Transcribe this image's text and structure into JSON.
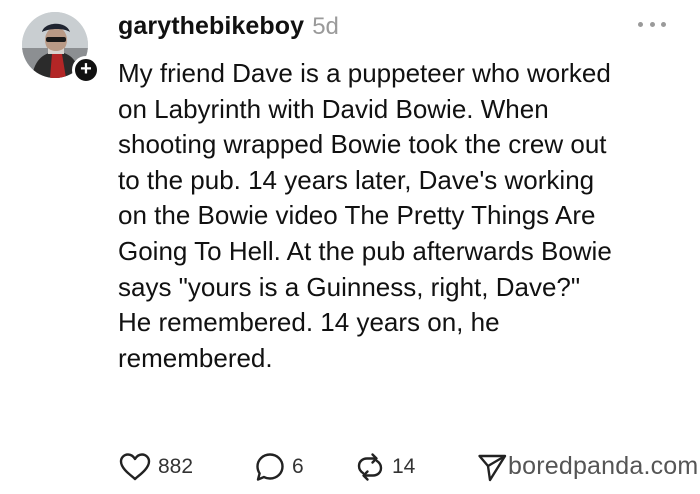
{
  "post": {
    "username": "garythebikeboy",
    "timestamp": "5d",
    "follow_badge": "+",
    "body_lines": [
      "My friend Dave is a puppeteer who worked",
      "on Labyrinth with David Bowie. When",
      "shooting wrapped Bowie took the crew out",
      "to the pub. 14 years later, Dave's working",
      "on the Bowie video The Pretty Things Are",
      "Going To Hell. At the pub afterwards Bowie",
      "says \"yours is a Guinness, right, Dave?\"",
      "He remembered. 14 years on, he",
      "remembered."
    ]
  },
  "actions": {
    "like": {
      "icon": "heart-icon",
      "count": "882"
    },
    "reply": {
      "icon": "comment-icon",
      "count": "6"
    },
    "repost": {
      "icon": "repost-icon",
      "count": "14"
    },
    "share": {
      "icon": "send-icon"
    }
  },
  "watermark": "boredpanda.com"
}
